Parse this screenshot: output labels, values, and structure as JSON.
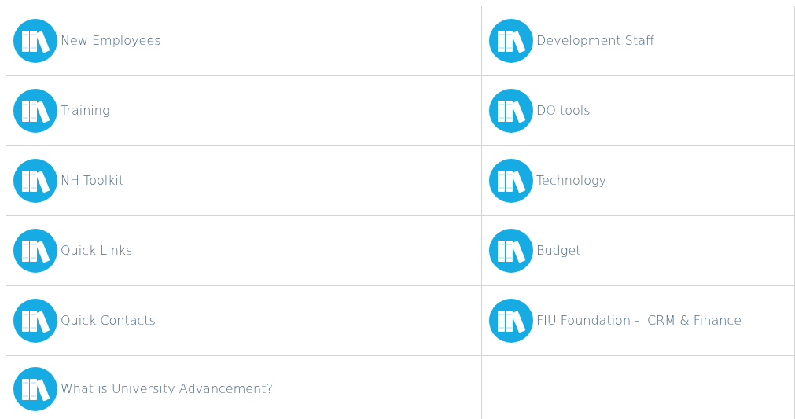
{
  "links": [
    {
      "label": "New Employees"
    },
    {
      "label": "Development Staff"
    },
    {
      "label": "Training"
    },
    {
      "label": "DO tools"
    },
    {
      "label": "NH Toolkit"
    },
    {
      "label": "Technology"
    },
    {
      "label": "Quick Links"
    },
    {
      "label": "Budget"
    },
    {
      "label": "Quick Contacts"
    },
    {
      "label": "FIU Foundation -  CRM & Finance"
    },
    {
      "label": "What is University Advancement?"
    }
  ]
}
